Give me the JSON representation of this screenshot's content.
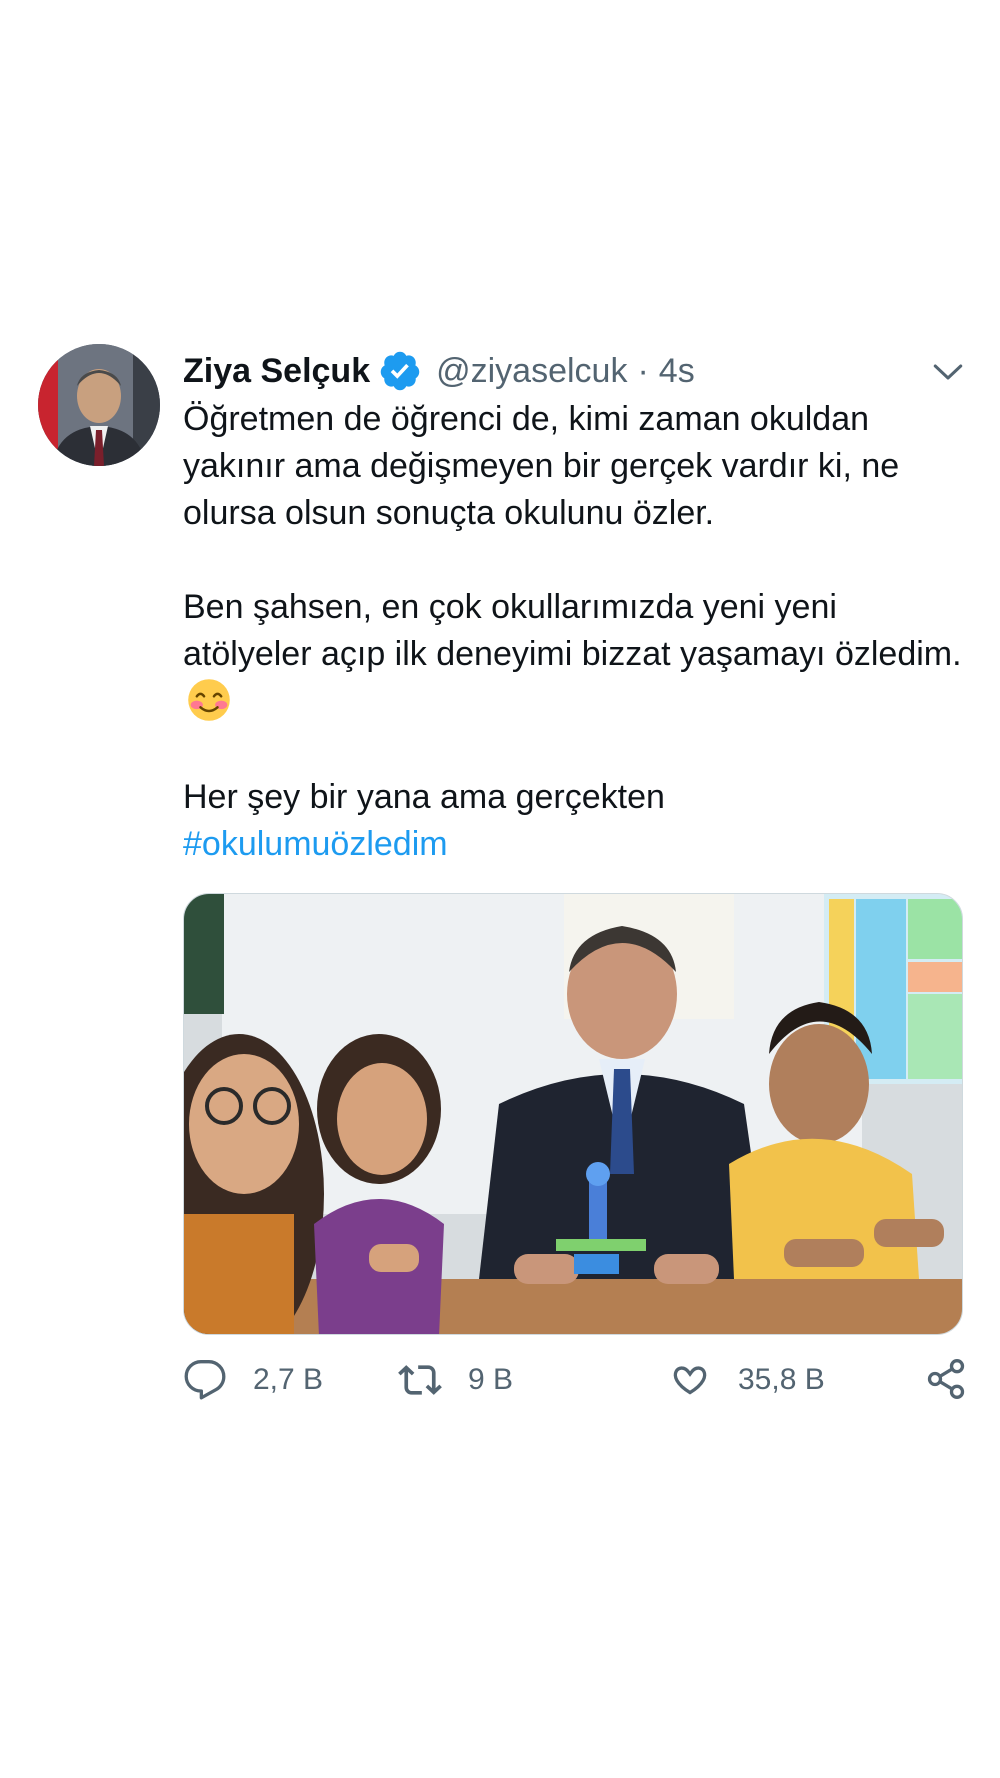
{
  "tweet": {
    "author": {
      "name": "Ziya Selçuk",
      "handle": "@ziyaselcuk",
      "separator": "·",
      "time": "4s",
      "verified": true,
      "avatar_icon": "profile-photo"
    },
    "text": {
      "p1": "Öğretmen de öğrenci de, kimi zaman okuldan yakınır ama değişmeyen bir gerçek vardır ki, ne olursa olsun sonuçta okulunu özler.",
      "p2": "Ben şahsen, en çok okullarımızda yeni yeni atölyeler açıp ilk deneyimi bizzat yaşamayı özledim.",
      "p2_emoji": "smiling-face-with-smiling-eyes",
      "p3": "Her şey bir yana ama gerçekten",
      "hashtag": "#okulumuözledim"
    },
    "media": {
      "type": "photo",
      "description_icon": "classroom-photo"
    },
    "actions": {
      "reply_count": "2,7 B",
      "retweet_count": "9 B",
      "like_count": "35,8 B"
    }
  },
  "colors": {
    "text": "#0f1419",
    "secondary": "#536471",
    "link": "#1d9bf0",
    "verified": "#1d9bf0"
  }
}
